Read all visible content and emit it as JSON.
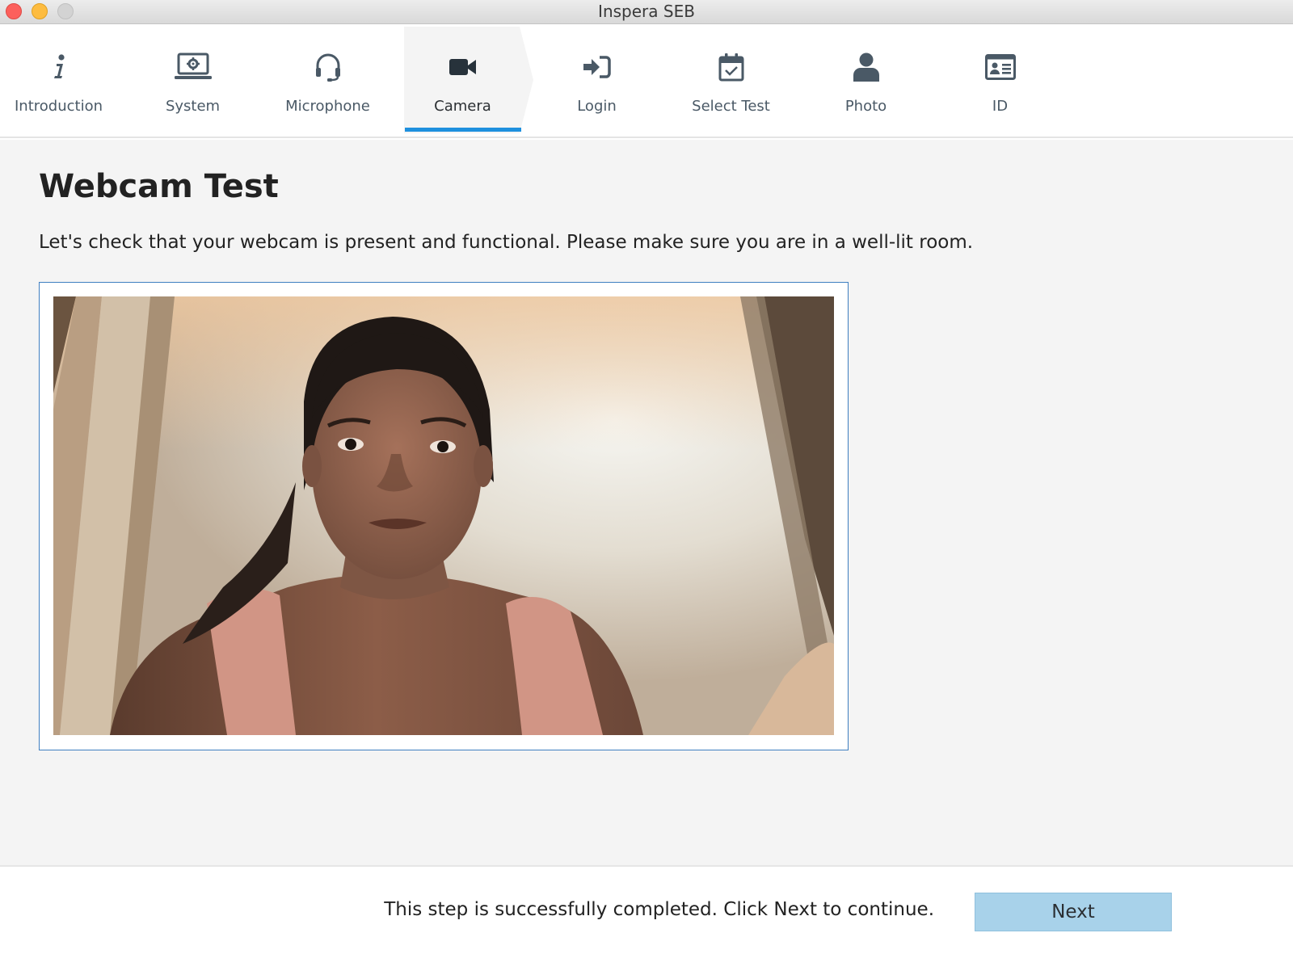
{
  "window": {
    "title": "Inspera SEB"
  },
  "steps": [
    {
      "label": "Introduction",
      "icon": "info-icon",
      "active": false
    },
    {
      "label": "System",
      "icon": "laptop-gear-icon",
      "active": false
    },
    {
      "label": "Microphone",
      "icon": "headset-icon",
      "active": false
    },
    {
      "label": "Camera",
      "icon": "video-camera-icon",
      "active": true
    },
    {
      "label": "Login",
      "icon": "sign-in-icon",
      "active": false
    },
    {
      "label": "Select Test",
      "icon": "calendar-check-icon",
      "active": false
    },
    {
      "label": "Photo",
      "icon": "user-icon",
      "active": false
    },
    {
      "label": "ID",
      "icon": "id-card-icon",
      "active": false
    }
  ],
  "main": {
    "title": "Webcam Test",
    "description": "Let's check that your webcam is present and functional. Please make sure you are in a well-lit room."
  },
  "footer": {
    "status": "This step is successfully completed. Click Next to continue.",
    "next_label": "Next"
  },
  "colors": {
    "accent": "#1e90de",
    "icon": "#4a5966",
    "active_icon": "#27323b",
    "next_button": "#a8d2ea",
    "frame_border": "#3f7fc0"
  }
}
